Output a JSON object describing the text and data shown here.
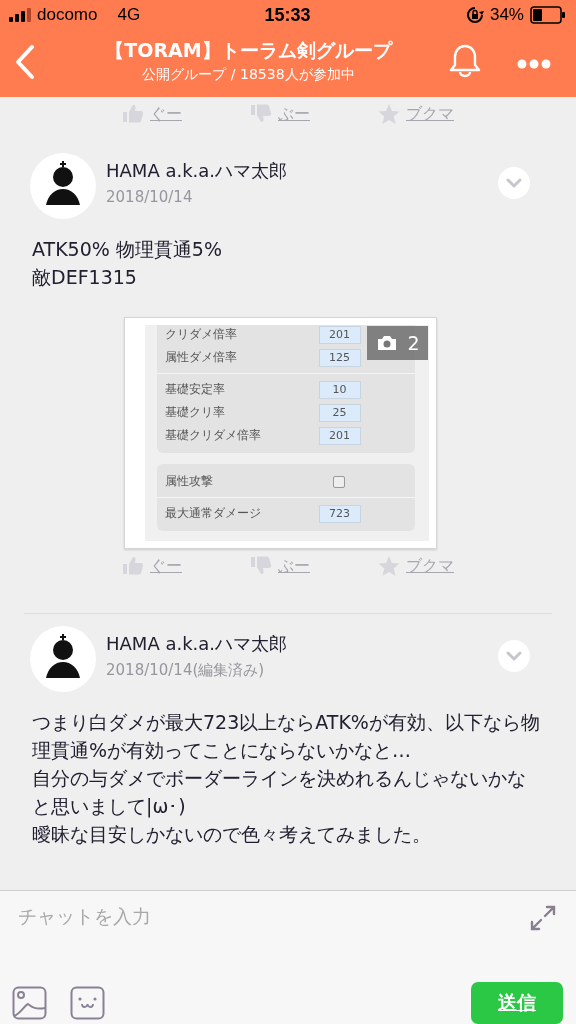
{
  "status_bar": {
    "carrier": "docomo",
    "network": "4G",
    "time": "15:33",
    "battery": "34%"
  },
  "header": {
    "title": "【TORAM】トーラム剣グループ",
    "subtitle": "公開グループ / 18538人が参加中"
  },
  "feed": [
    {
      "kind": "reactions",
      "items": [
        {
          "kind": "good",
          "label": "ぐー"
        },
        {
          "kind": "bad",
          "label": "ぶー"
        },
        {
          "kind": "bookmark",
          "label": "ブクマ"
        }
      ]
    },
    {
      "kind": "post",
      "author": "HAMA a.k.a.ハマ太郎",
      "date": "2018/10/14",
      "text": "ATK50% 物理貫通5%\n敵DEF1315",
      "image": {
        "count": "2",
        "groups": [
          {
            "sections": [
              [
                {
                  "kind": "value",
                  "label": "クリダメ倍率",
                  "value": "201"
                },
                {
                  "kind": "value",
                  "label": "属性ダメ倍率",
                  "value": "125"
                }
              ],
              [
                {
                  "kind": "value",
                  "label": "基礎安定率",
                  "value": "10"
                },
                {
                  "kind": "value",
                  "label": "基礎クリ率",
                  "value": "25"
                },
                {
                  "kind": "value",
                  "label": "基礎クリダメ倍率",
                  "value": "201"
                }
              ]
            ]
          },
          {
            "sections": [
              [
                {
                  "kind": "check",
                  "label": "属性攻撃",
                  "checked": false
                }
              ],
              [
                {
                  "kind": "value",
                  "label": "最大通常ダメージ",
                  "value": "723"
                }
              ]
            ]
          }
        ]
      }
    },
    {
      "kind": "reactions",
      "items": [
        {
          "kind": "good",
          "label": "ぐー"
        },
        {
          "kind": "bad",
          "label": "ぶー"
        },
        {
          "kind": "bookmark",
          "label": "ブクマ"
        }
      ]
    },
    {
      "kind": "post",
      "author": "HAMA a.k.a.ハマ太郎",
      "date": "2018/10/14(編集済み)",
      "text": "つまり白ダメが最大723以上ならATK%が有効、以下なら物理貫通%が有効ってことにならないかなと…\n自分の与ダメでボーダーラインを決めれるんじゃないかなと思いまして|ω･)\n曖昧な目安しかないので色々考えてみました。"
    }
  ],
  "composer": {
    "placeholder": "チャットを入力",
    "send": "送信"
  }
}
